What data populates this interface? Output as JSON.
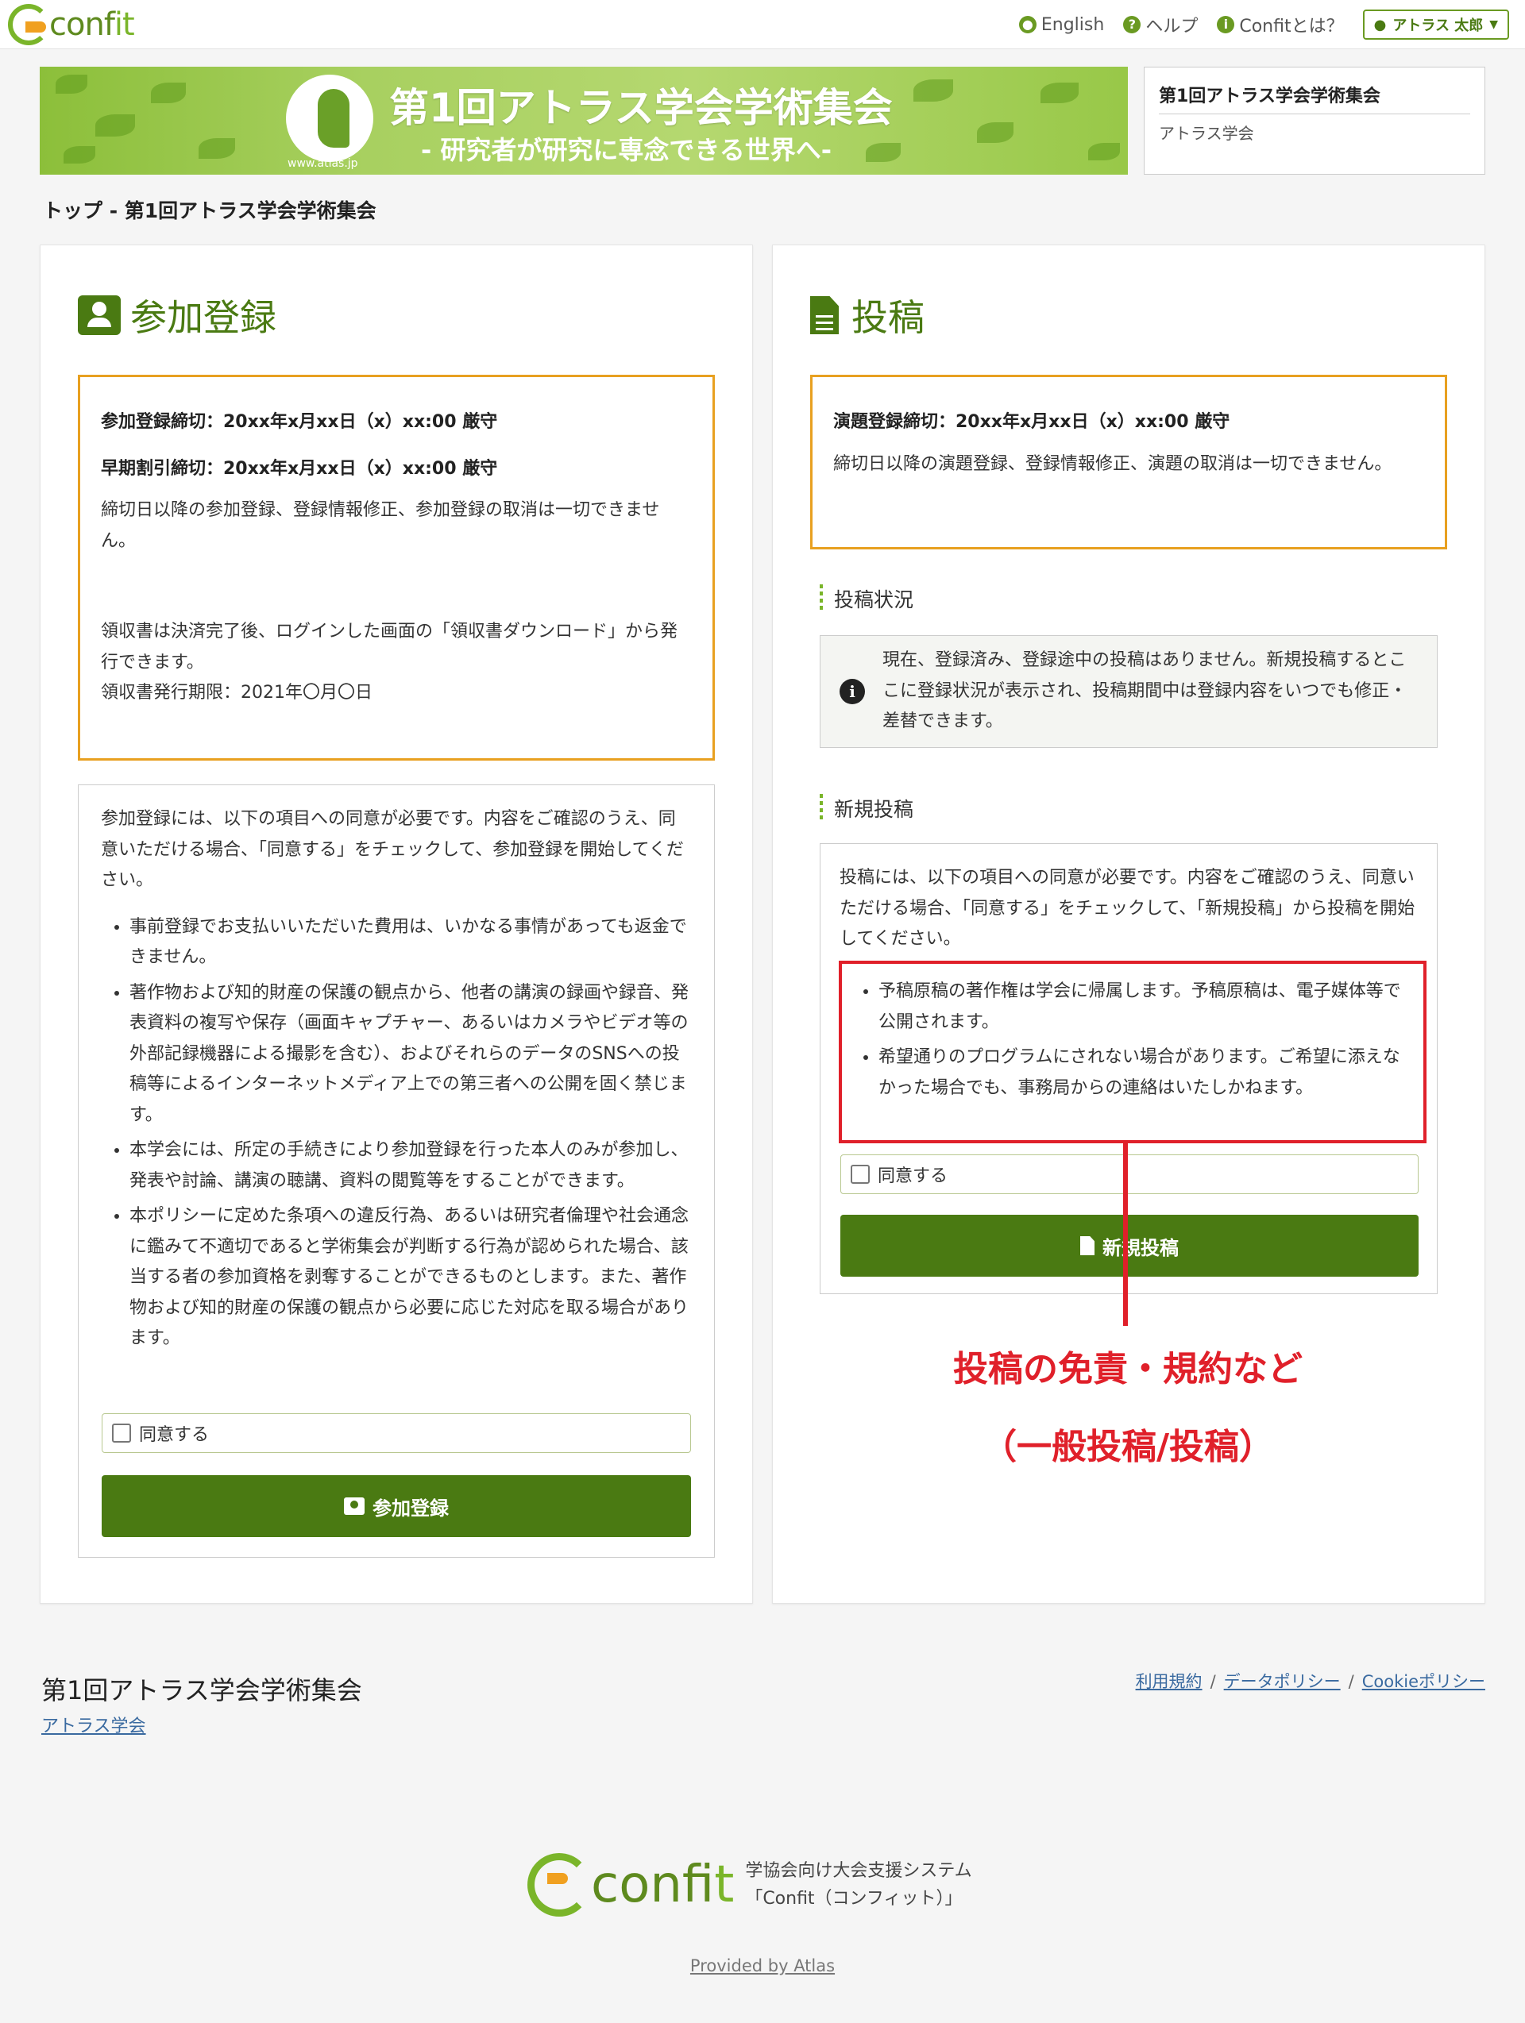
{
  "brand": {
    "wordmark_main": "conf",
    "wordmark_it": "it"
  },
  "nav": {
    "english": "English",
    "help": "ヘルプ",
    "about": "Confitとは？",
    "user": "アトラス 太郎"
  },
  "banner": {
    "title": "第1回アトラス学会学術集会",
    "subtitle": "- 研究者が研究に専念できる世界へ-",
    "url": "www.atlas.jp"
  },
  "confbox": {
    "title": "第1回アトラス学会学術集会",
    "org": "アトラス学会"
  },
  "breadcrumb": "トップ - 第1回アトラス学会学術集会",
  "registration": {
    "title": "参加登録",
    "deadline": "参加登録締切：20xx年x月xx日（x）xx:00 厳守",
    "early": "早期割引締切：20xx年x月xx日（x）xx:00 厳守",
    "note": "締切日以降の参加登録、登録情報修正、参加登録の取消は一切できません。",
    "receipt": "領収書は決済完了後、ログインした画面の「領収書ダウンロード」から発行できます。",
    "receipt_limit": "領収書発行期限：2021年〇月〇日",
    "intro": "参加登録には、以下の項目への同意が必要です。内容をご確認のうえ、同意いただける場合、「同意する」をチェックして、参加登録を開始してください。",
    "items": [
      "事前登録でお支払いいただいた費用は、いかなる事情があっても返金できません。",
      "著作物および知的財産の保護の観点から、他者の講演の録画や録音、発表資料の複写や保存（画面キャプチャー、あるいはカメラやビデオ等の外部記録機器による撮影を含む）、およびそれらのデータのSNSへの投稿等によるインターネットメディア上での第三者への公開を固く禁じます。",
      "本学会には、所定の手続きにより参加登録を行った本人のみが参加し、発表や討論、講演の聴講、資料の閲覧等をすることができます。",
      "本ポリシーに定めた条項への違反行為、あるいは研究者倫理や社会通念に鑑みて不適切であると学術集会が判断する行為が認められた場合、該当する者の参加資格を剥奪することができるものとします。また、著作物および知的財産の保護の観点から必要に応じた対応を取る場合があります。"
    ],
    "agree": "同意する",
    "button": "参加登録"
  },
  "submission": {
    "title": "投稿",
    "deadline": "演題登録締切：20xx年x月xx日（x）xx:00 厳守",
    "note": "締切日以降の演題登録、登録情報修正、演題の取消は一切できません。",
    "status_head": "投稿状況",
    "status_text": "現在、登録済み、登録途中の投稿はありません。新規投稿するとここに登録状況が表示され、投稿期間中は登録内容をいつでも修正・差替できます。",
    "new_head": "新規投稿",
    "intro": "投稿には、以下の項目への同意が必要です。内容をご確認のうえ、同意いただける場合、「同意する」をチェックして、「新規投稿」から投稿を開始してください。",
    "items": [
      "予稿原稿の著作権は学会に帰属します。予稿原稿は、電子媒体等で公開されます。",
      "希望通りのプログラムにされない場合があります。ご希望に添えなかった場合でも、事務局からの連絡はいたしかねます。"
    ],
    "agree": "同意する",
    "button": "新規投稿"
  },
  "annotation": {
    "line1": "投稿の免責・規約など",
    "line2": "（一般投稿/投稿）"
  },
  "footer": {
    "title": "第1回アトラス学会学術集会",
    "org": "アトラス学会",
    "links": [
      "利用規約",
      "データポリシー",
      "Cookieポリシー"
    ],
    "tagline1": "学協会向け大会支援システム",
    "tagline2": "「Confit（コンフィット）」",
    "provided": "Provided by Atlas"
  },
  "colors": {
    "brand_green": "#4a7a12",
    "notice_border": "#e8a020",
    "annotation_red": "#e0202a"
  }
}
